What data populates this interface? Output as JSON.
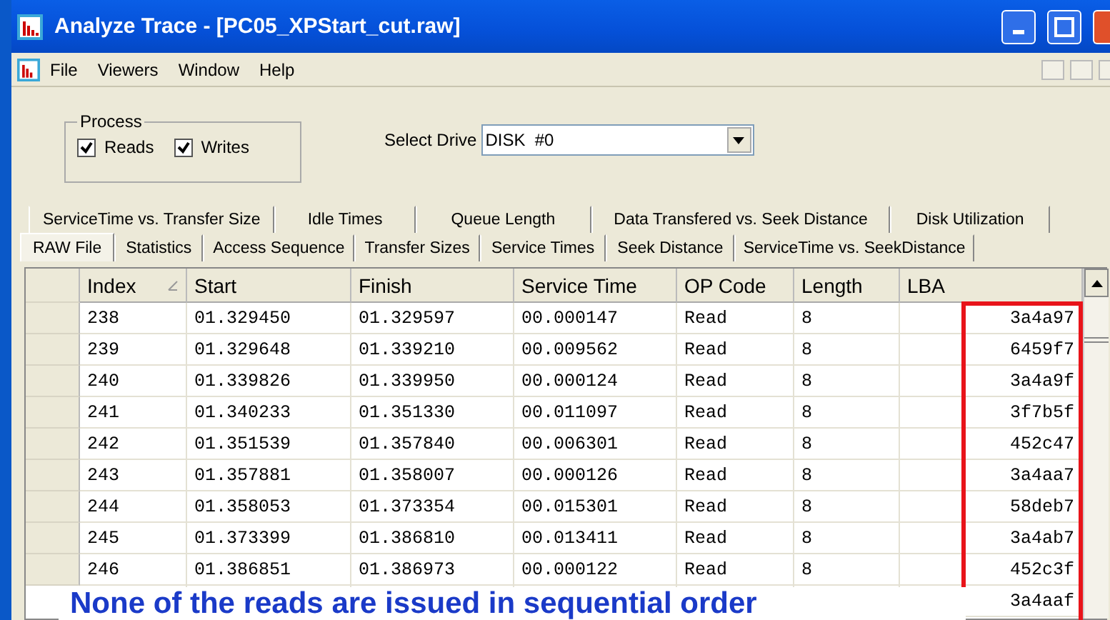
{
  "window": {
    "title": "Analyze Trace - [PC05_XPStart_cut.raw]"
  },
  "menu": [
    "File",
    "Viewers",
    "Window",
    "Help"
  ],
  "process": {
    "title": "Process",
    "options": [
      {
        "label": "Reads",
        "checked": true
      },
      {
        "label": "Writes",
        "checked": true
      }
    ]
  },
  "drive": {
    "label": "Select Drive",
    "value": "DISK  #0"
  },
  "tabs_back": [
    {
      "label": "ServiceTime  vs. Transfer Size",
      "selected": false
    },
    {
      "label": "Idle Times",
      "selected": false
    },
    {
      "label": "Queue Length",
      "selected": false
    },
    {
      "label": "Data Transfered vs. Seek Distance",
      "selected": false
    },
    {
      "label": "Disk Utilization",
      "selected": false
    }
  ],
  "tabs_front": [
    {
      "label": "RAW File",
      "selected": true
    },
    {
      "label": "Statistics",
      "selected": false
    },
    {
      "label": "Access Sequence",
      "selected": false
    },
    {
      "label": "Transfer Sizes",
      "selected": false
    },
    {
      "label": "Service Times",
      "selected": false
    },
    {
      "label": "Seek Distance",
      "selected": false
    },
    {
      "label": "ServiceTime vs. SeekDistance",
      "selected": false
    }
  ],
  "table": {
    "columns": [
      "Index",
      "Start",
      "Finish",
      "Service Time",
      "OP Code",
      "Length",
      "LBA"
    ],
    "rows": [
      {
        "index": "238",
        "start": "01.329450",
        "finish": "01.329597",
        "service": "00.000147",
        "op": "Read",
        "length": "8",
        "lba": "3a4a97"
      },
      {
        "index": "239",
        "start": "01.329648",
        "finish": "01.339210",
        "service": "00.009562",
        "op": "Read",
        "length": "8",
        "lba": "6459f7"
      },
      {
        "index": "240",
        "start": "01.339826",
        "finish": "01.339950",
        "service": "00.000124",
        "op": "Read",
        "length": "8",
        "lba": "3a4a9f"
      },
      {
        "index": "241",
        "start": "01.340233",
        "finish": "01.351330",
        "service": "00.011097",
        "op": "Read",
        "length": "8",
        "lba": "3f7b5f"
      },
      {
        "index": "242",
        "start": "01.351539",
        "finish": "01.357840",
        "service": "00.006301",
        "op": "Read",
        "length": "8",
        "lba": "452c47"
      },
      {
        "index": "243",
        "start": "01.357881",
        "finish": "01.358007",
        "service": "00.000126",
        "op": "Read",
        "length": "8",
        "lba": "3a4aa7"
      },
      {
        "index": "244",
        "start": "01.358053",
        "finish": "01.373354",
        "service": "00.015301",
        "op": "Read",
        "length": "8",
        "lba": "58deb7"
      },
      {
        "index": "245",
        "start": "01.373399",
        "finish": "01.386810",
        "service": "00.013411",
        "op": "Read",
        "length": "8",
        "lba": "3a4ab7"
      },
      {
        "index": "246",
        "start": "01.386851",
        "finish": "01.386973",
        "service": "00.000122",
        "op": "Read",
        "length": "8",
        "lba": "452c3f"
      },
      {
        "lba": "3a4aaf"
      }
    ]
  },
  "caption": "None of the reads are issued in sequential order"
}
